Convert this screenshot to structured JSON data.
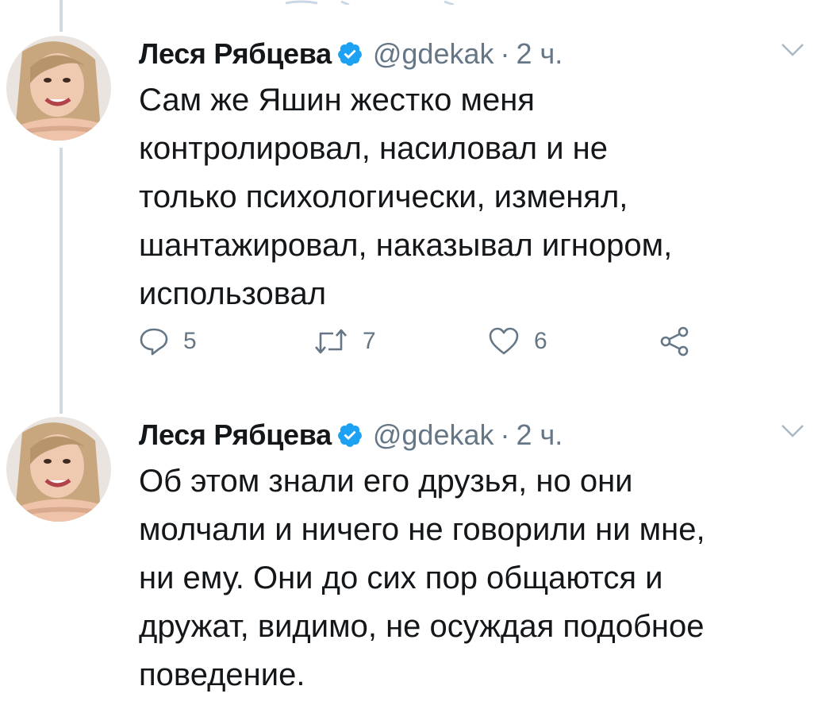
{
  "tweets": [
    {
      "author_name": "Леся Рябцева",
      "handle": "@gdekak",
      "separator": "·",
      "time": "2 ч.",
      "text_lines": [
        "Сам же Яшин жестко меня",
        "контролировал, насиловал и не",
        "только психологически, изменял,",
        "шантажировал, наказывал игнором,",
        "использовал"
      ],
      "actions": {
        "replies": "5",
        "retweets": "7",
        "likes": "6"
      }
    },
    {
      "author_name": "Леся Рябцева",
      "handle": "@gdekak",
      "separator": "·",
      "time": "2 ч.",
      "text_lines": [
        "Об этом знали его друзья, но они",
        "молчали и ничего не говорили ни мне,",
        "ни ему. Они до сих пор общаются и",
        "дружат, видимо, не осуждая подобное",
        "поведение."
      ]
    }
  ],
  "icons": {
    "verified": "verified-badge-icon",
    "caret": "chevron-down-icon",
    "reply": "reply-icon",
    "retweet": "retweet-icon",
    "like": "heart-icon",
    "share": "share-icon"
  },
  "colors": {
    "verified": "#1da1f2",
    "text": "#14171a",
    "secondary": "#657786",
    "thread_line": "#cfd9de"
  }
}
